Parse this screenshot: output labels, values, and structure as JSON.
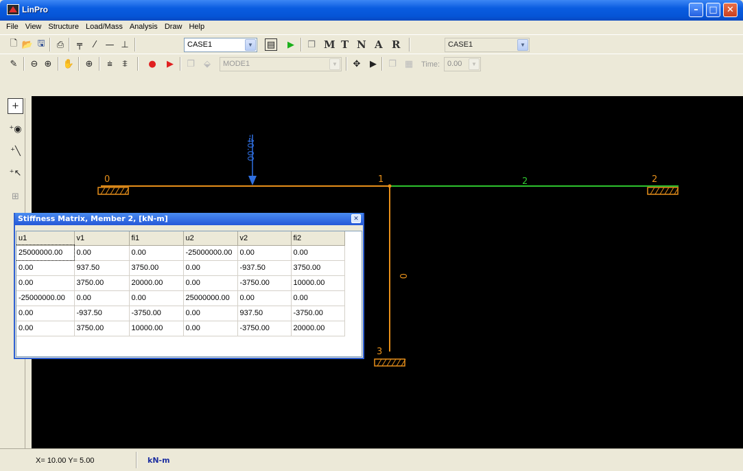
{
  "app": {
    "title": "LinPro"
  },
  "menu": [
    "File",
    "View",
    "Structure",
    "Load/Mass",
    "Analysis",
    "Draw",
    "Help"
  ],
  "toolbar1": {
    "case_left": "CASE1",
    "letters": [
      "M",
      "T",
      "N",
      "A",
      "R"
    ],
    "case_right": "CASE1"
  },
  "toolbar2": {
    "mode": "MODE1",
    "time_label": "Time:",
    "time_value": "0.00"
  },
  "structure": {
    "node_labels": [
      "0",
      "1",
      "2",
      "3"
    ],
    "member_labels": [
      "2",
      "0"
    ],
    "load_value": "-40.00",
    "colors": {
      "frame": "#e8901a",
      "member2": "#2ec42e",
      "load": "#2f6fe0",
      "text": "#e8901a"
    }
  },
  "dialog": {
    "title": "Stiffness Matrix, Member 2,  [kN-m]",
    "columns": [
      "u1",
      "v1",
      "fi1",
      "u2",
      "v2",
      "fi2"
    ],
    "rows": [
      [
        "25000000.00",
        "0.00",
        "0.00",
        "-25000000.00",
        "0.00",
        "0.00"
      ],
      [
        "0.00",
        "937.50",
        "3750.00",
        "0.00",
        "-937.50",
        "3750.00"
      ],
      [
        "0.00",
        "3750.00",
        "20000.00",
        "0.00",
        "-3750.00",
        "10000.00"
      ],
      [
        "-25000000.00",
        "0.00",
        "0.00",
        "25000000.00",
        "0.00",
        "0.00"
      ],
      [
        "0.00",
        "-937.50",
        "-3750.00",
        "0.00",
        "937.50",
        "-3750.00"
      ],
      [
        "0.00",
        "3750.00",
        "10000.00",
        "0.00",
        "-3750.00",
        "20000.00"
      ]
    ]
  },
  "status": {
    "coords": "X= 10.00  Y= 5.00",
    "units": "kN-m"
  }
}
